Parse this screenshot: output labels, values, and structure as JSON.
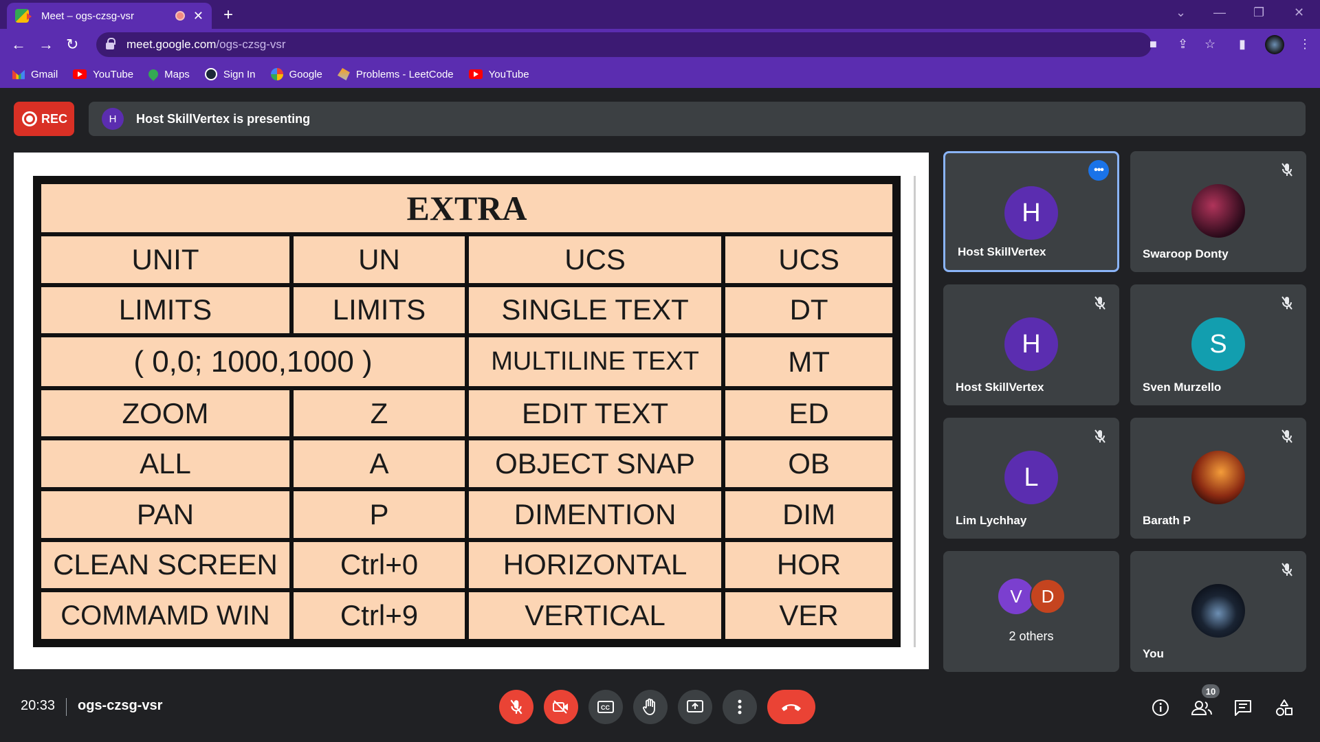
{
  "browser": {
    "tab_title": "Meet – ogs-czsg-vsr",
    "new_tab": "+",
    "url_host": "meet.google.com",
    "url_path": "/ogs-czsg-vsr",
    "bookmarks": [
      {
        "label": "Gmail",
        "icon": "gmail-icon"
      },
      {
        "label": "YouTube",
        "icon": "youtube-icon"
      },
      {
        "label": "Maps",
        "icon": "maps-icon"
      },
      {
        "label": "Sign In",
        "icon": "steam-icon"
      },
      {
        "label": "Google",
        "icon": "google-icon"
      },
      {
        "label": "Problems - LeetCode",
        "icon": "leetcode-icon"
      },
      {
        "label": "YouTube",
        "icon": "youtube-icon"
      }
    ]
  },
  "meeting": {
    "rec_label": "REC",
    "presenter_initial": "H",
    "presenting_text": "Host SkillVertex is presenting",
    "time": "20:33",
    "code": "ogs-czsg-vsr",
    "participant_count": "10"
  },
  "slide": {
    "title": "EXTRA",
    "rows": [
      [
        "UNIT",
        "UN",
        "UCS",
        "UCS"
      ],
      [
        "LIMITS",
        "LIMITS",
        "SINGLE TEXT",
        "DT"
      ],
      [
        "( 0,0; 1000,1000 )",
        "",
        "MULTILINE TEXT",
        "MT"
      ],
      [
        "ZOOM",
        "Z",
        "EDIT TEXT",
        "ED"
      ],
      [
        "ALL",
        "A",
        "OBJECT SNAP",
        "OB"
      ],
      [
        "PAN",
        "P",
        "DIMENTION",
        "DIM"
      ],
      [
        "CLEAN SCREEN",
        "Ctrl+0",
        "HORIZONTAL",
        "HOR"
      ],
      [
        "COMMAMD WIN",
        "Ctrl+9",
        "VERTICAL",
        "VER"
      ]
    ]
  },
  "participants": [
    {
      "name": "Host SkillVertex",
      "initial": "H",
      "color": "#5b2db0"
    },
    {
      "name": "Swaroop Donty",
      "initial": "",
      "color": ""
    },
    {
      "name": "Host SkillVertex",
      "initial": "H",
      "color": "#5b2db0"
    },
    {
      "name": "Sven Murzello",
      "initial": "S",
      "color": "#129eaf"
    },
    {
      "name": "Lim Lychhay",
      "initial": "L",
      "color": "#5b2db0"
    },
    {
      "name": "Barath P",
      "initial": "",
      "color": ""
    },
    {
      "others_label": "2 others",
      "initial_a": "V",
      "color_a": "#7b3fcf",
      "initial_b": "D",
      "color_b": "#c5441f"
    },
    {
      "name": "You",
      "initial": "",
      "color": ""
    }
  ],
  "colors": {
    "accent": "#8ab4f8",
    "danger": "#ea4335",
    "rec": "#d93025",
    "tab_purple": "#5b2db0"
  }
}
